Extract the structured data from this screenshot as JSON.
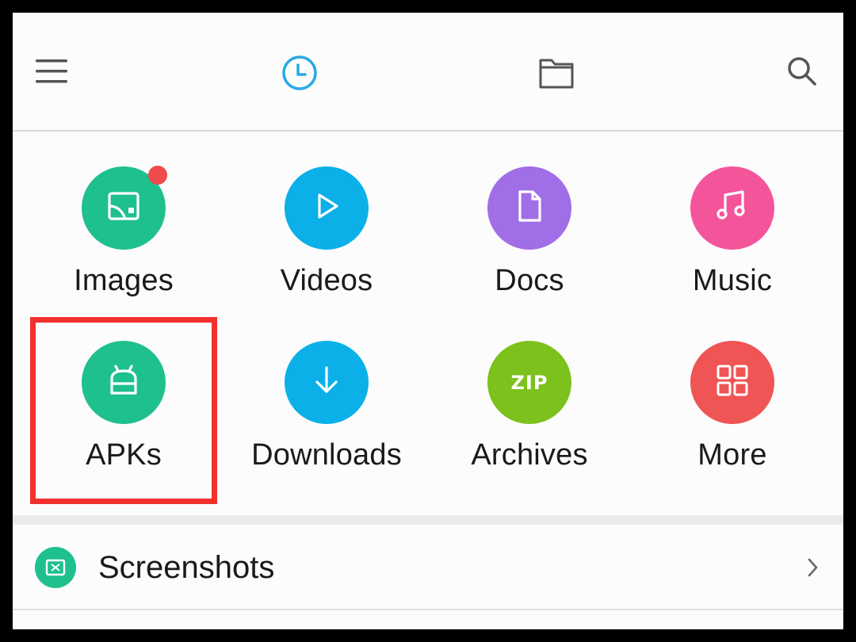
{
  "topbar": {
    "icons": [
      "menu-icon",
      "recent-clock-icon",
      "folder-icon",
      "search-icon"
    ]
  },
  "categories": [
    {
      "label": "Images",
      "icon": "image-icon",
      "color": "#1ec08e",
      "has_badge": true
    },
    {
      "label": "Videos",
      "icon": "play-icon",
      "color": "#0bb0e9"
    },
    {
      "label": "Docs",
      "icon": "document-icon",
      "color": "#a06ee6"
    },
    {
      "label": "Music",
      "icon": "music-note-icon",
      "color": "#f4549a"
    },
    {
      "label": "APKs",
      "icon": "android-icon",
      "color": "#1ec08e",
      "highlighted": true
    },
    {
      "label": "Downloads",
      "icon": "download-arrow-icon",
      "color": "#0bb0e9"
    },
    {
      "label": "Archives",
      "icon": "zip-icon",
      "icon_text": "ZIP",
      "color": "#7cc11c"
    },
    {
      "label": "More",
      "icon": "grid-icon",
      "color": "#ef5554"
    }
  ],
  "highlight_color": "#f2302d",
  "list": [
    {
      "label": "Screenshots",
      "icon": "screenshot-icon",
      "color": "#1ec08e"
    }
  ]
}
